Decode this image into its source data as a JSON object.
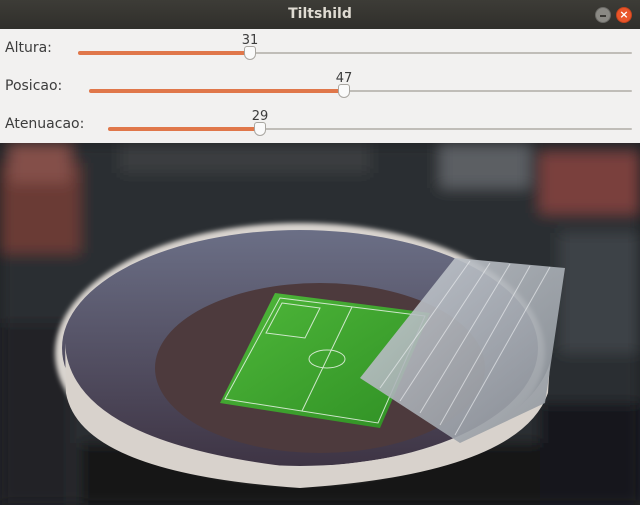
{
  "window": {
    "title": "Tiltshild"
  },
  "controls": {
    "altura": {
      "label": "Altura:",
      "value": "31",
      "fraction": 0.31
    },
    "posicao": {
      "label": "Posicao:",
      "value": "47",
      "fraction": 0.47
    },
    "atenuacao": {
      "label": "Atenuacao:",
      "value": "29",
      "fraction": 0.29
    }
  },
  "colors": {
    "accent": "#e0774a",
    "titlebar": "#3d3c37",
    "close": "#e9552a"
  },
  "icons": {
    "minimize": "minimize-icon",
    "close": "close-icon"
  }
}
